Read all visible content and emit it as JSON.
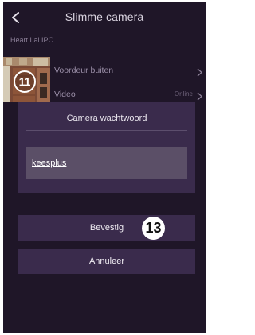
{
  "header": {
    "title": "Slimme camera",
    "back_icon": "chevron-left-icon"
  },
  "subtitle": "Heart Lai IPC",
  "camera_list": {
    "thumbnail_step": "11",
    "rows": [
      {
        "label": "Voordeur buiten",
        "status": ""
      },
      {
        "label": "Video",
        "status": "Online"
      }
    ]
  },
  "dialog": {
    "title": "Camera wachtwoord",
    "password_value": "keesplus"
  },
  "buttons": {
    "confirm": "Bevestig",
    "cancel": "Annuleer"
  },
  "step_badge": "13",
  "colors": {
    "background": "#1f1628",
    "panel": "#3a2b4c",
    "field": "#5b4f67",
    "text": "#eae6ee"
  }
}
